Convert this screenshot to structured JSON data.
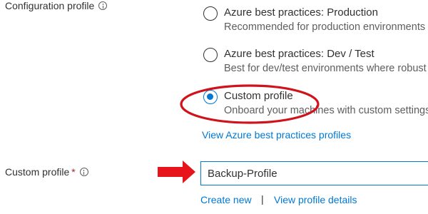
{
  "config_profile": {
    "label": "Configuration profile",
    "options": [
      {
        "title": "Azure best practices: Production",
        "description": "Recommended for production environments",
        "selected": false
      },
      {
        "title": "Azure best practices: Dev / Test",
        "description": "Best for dev/test environments where robust",
        "selected": false
      },
      {
        "title": "Custom profile",
        "description": "Onboard your machines with custom settings",
        "selected": true
      }
    ],
    "link": "View Azure best practices profiles"
  },
  "custom_profile": {
    "label": "Custom profile",
    "required_mark": "*",
    "value": "Backup-Profile",
    "create_new": "Create new",
    "separator": "|",
    "view_details": "View profile details"
  },
  "annotations": {
    "circle_color": "#d0121b",
    "arrow_color": "#e8141c"
  },
  "colors": {
    "accent": "#0078d4",
    "text": "#323130",
    "muted": "#605e5c"
  }
}
